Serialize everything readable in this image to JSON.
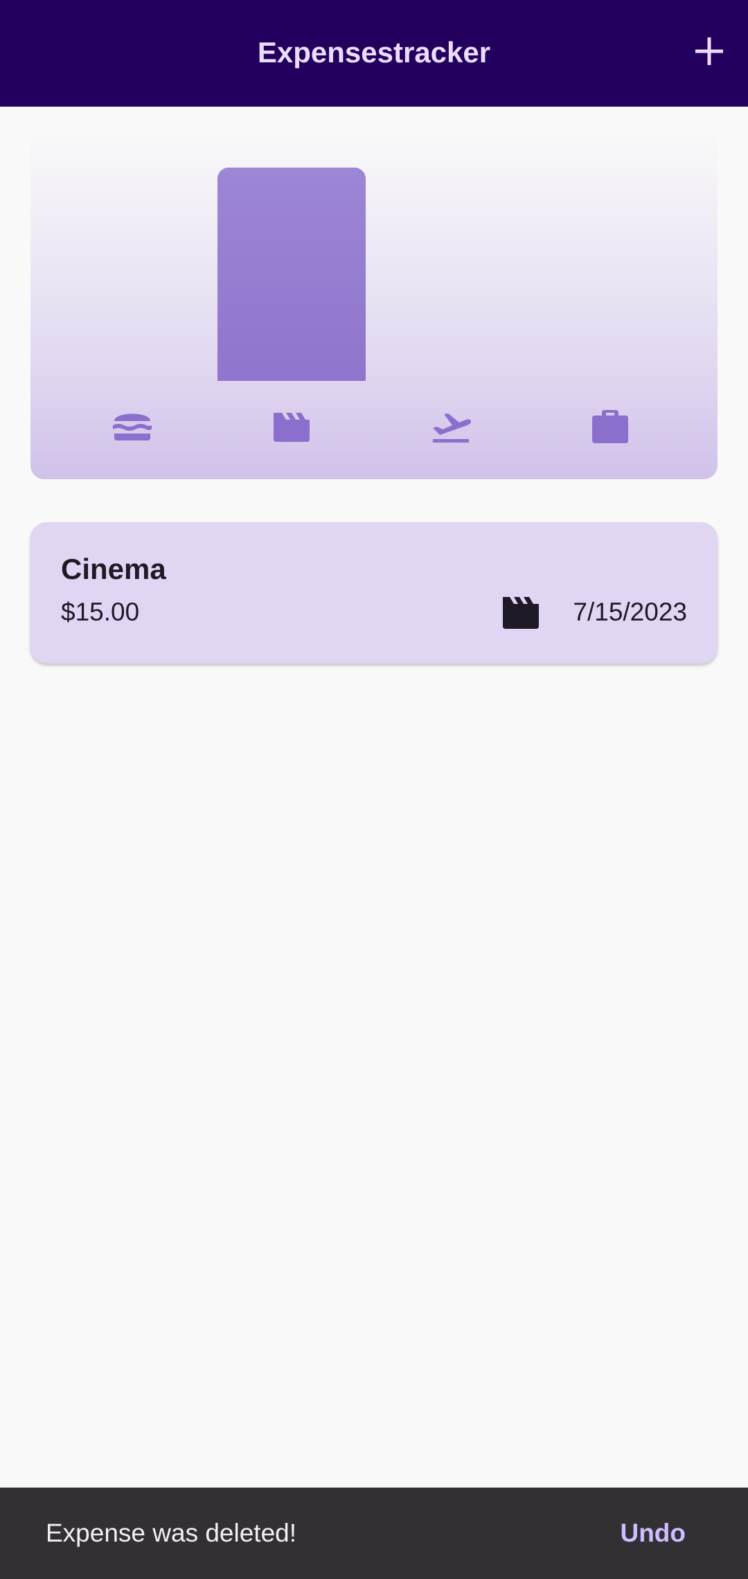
{
  "appbar": {
    "title": "Expensestracker",
    "add_icon": "plus-icon"
  },
  "chart": {
    "categories": [
      {
        "icon": "hamburger-icon",
        "name": "food",
        "value": 0
      },
      {
        "icon": "movie-clapper-icon",
        "name": "leisure",
        "value": 1
      },
      {
        "icon": "flight-takeoff-icon",
        "name": "travel",
        "value": 0
      },
      {
        "icon": "briefcase-icon",
        "name": "work",
        "value": 0
      }
    ],
    "max_value": 1,
    "colors": {
      "bar": "#9580D1",
      "icon": "#8B6FCC"
    }
  },
  "expenses": [
    {
      "title": "Cinema",
      "amount": "$15.00",
      "category_icon": "movie-clapper-icon",
      "date": "7/15/2023"
    }
  ],
  "snackbar": {
    "message": "Expense was deleted!",
    "action": "Undo"
  },
  "colors": {
    "appbar_bg": "#23005E",
    "appbar_text": "#EBDDFF",
    "card_bg": "#E1D5F4",
    "snackbar_bg": "#323033",
    "snackbar_action": "#D0BCFF"
  }
}
